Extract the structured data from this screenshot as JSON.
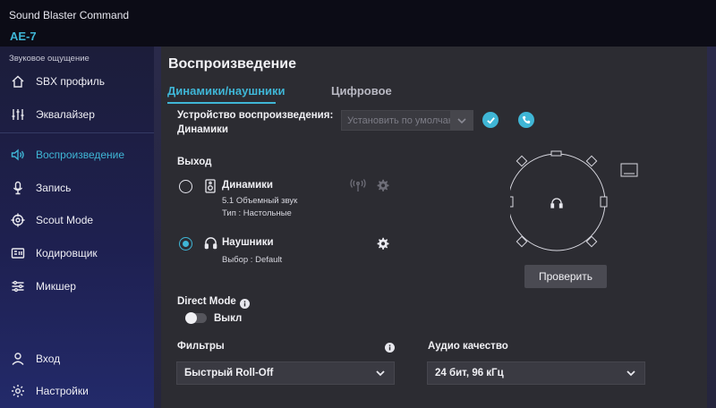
{
  "app": {
    "title": "Sound Blaster Command",
    "device": "AE-7"
  },
  "sidebar": {
    "caption": "Звуковое ощущение",
    "items": [
      {
        "label": "SBX профиль",
        "icon": "home-icon"
      },
      {
        "label": "Эквалайзер",
        "icon": "equalizer-icon"
      },
      {
        "label": "Воспроизведение",
        "icon": "speaker-icon",
        "active": true
      },
      {
        "label": "Запись",
        "icon": "microphone-icon"
      },
      {
        "label": "Scout Mode",
        "icon": "crosshair-icon"
      },
      {
        "label": "Кодировщик",
        "icon": "encoder-icon"
      },
      {
        "label": "Микшер",
        "icon": "mixer-icon"
      }
    ],
    "bottom_items": [
      {
        "label": "Вход",
        "icon": "user-icon"
      },
      {
        "label": "Настройки",
        "icon": "gear-icon"
      }
    ]
  },
  "main": {
    "title": "Воспроизведение",
    "tabs": [
      {
        "label": "Динамики/наушники",
        "active": true
      },
      {
        "label": "Цифровое",
        "active": false
      }
    ],
    "playback_device": {
      "label": "Устройство воспроизведения:",
      "value": "Динамики",
      "select_placeholder": "Установить по умолчан"
    },
    "output": {
      "label": "Выход",
      "speakers": {
        "name": "Динамики",
        "line1": "5.1 Объемный звук",
        "line2": "Тип :  Настольные",
        "selected": false
      },
      "headphones": {
        "name": "Наушники",
        "line1": "Выбор :  Default",
        "selected": true
      }
    },
    "test_button": "Проверить",
    "direct_mode": {
      "label": "Direct Mode",
      "state": "Выкл"
    },
    "filters": {
      "label": "Фильтры",
      "value": "Быстрый Roll-Off"
    },
    "audio_quality": {
      "label": "Аудио качество",
      "value": "24 бит, 96 кГц"
    }
  },
  "colors": {
    "accent": "#3fb6d6",
    "panel": "#2c2c32",
    "sidebar": "#1e2050"
  }
}
